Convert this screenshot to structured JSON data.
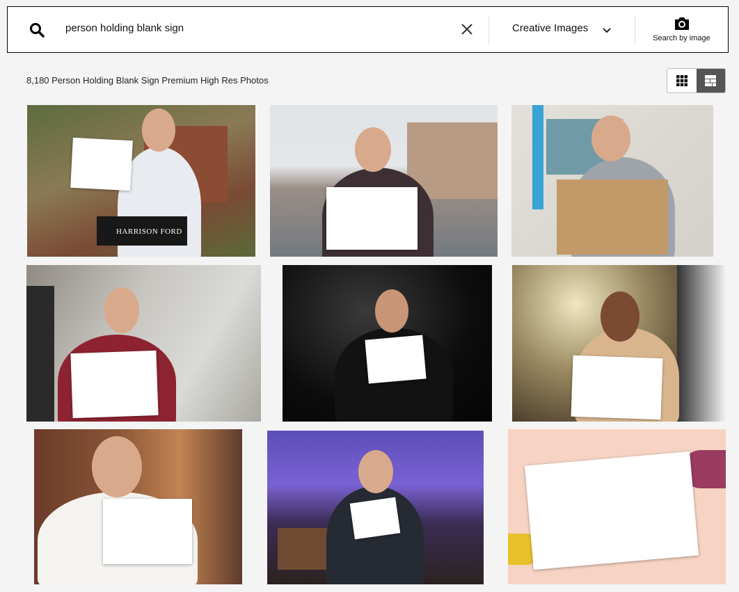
{
  "search": {
    "query": "person holding blank sign",
    "image_type": "Creative Images",
    "by_image_label": "Search by image"
  },
  "results": {
    "count_text": "8,180 Person Holding Blank Sign Premium High Res Photos"
  },
  "images": [
    {
      "chair_text": "HARRISON FORD"
    }
  ],
  "colors": {
    "background": "#f4f4f4",
    "toggle_active": "#555555"
  },
  "icons": [
    "search-icon",
    "close-icon",
    "chevron-down-icon",
    "camera-icon",
    "grid-view-icon",
    "mosaic-view-icon"
  ]
}
